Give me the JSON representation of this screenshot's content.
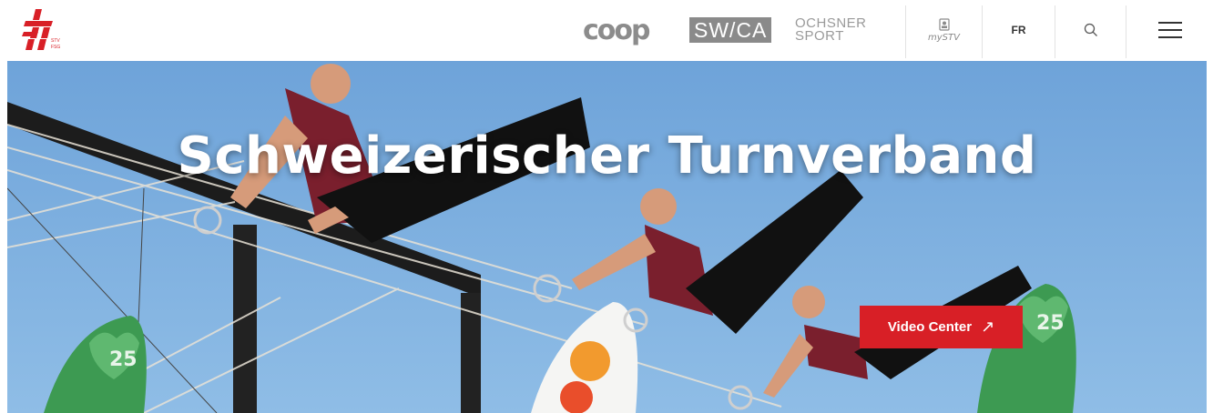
{
  "header": {
    "logo_text": "STV FSG",
    "sponsors": {
      "coop": "coop",
      "swica": "SW/CA",
      "ochsner_line1": "OCHSNER",
      "ochsner_line2": "SPORT"
    },
    "mystv_label": "mySTV",
    "language": "FR"
  },
  "hero": {
    "title": "Schweizerischer Turnverband",
    "video_button": "Video Center",
    "video_button_arrow": "↗",
    "banner_text": "25"
  },
  "colors": {
    "accent": "#d81f26",
    "sky": "#7fb0df",
    "sponsor_gray": "#8a8a8a"
  },
  "icons": [
    "stv-logo-icon",
    "mystv-icon",
    "search-icon",
    "hamburger-menu-icon",
    "arrow-up-right-icon"
  ]
}
